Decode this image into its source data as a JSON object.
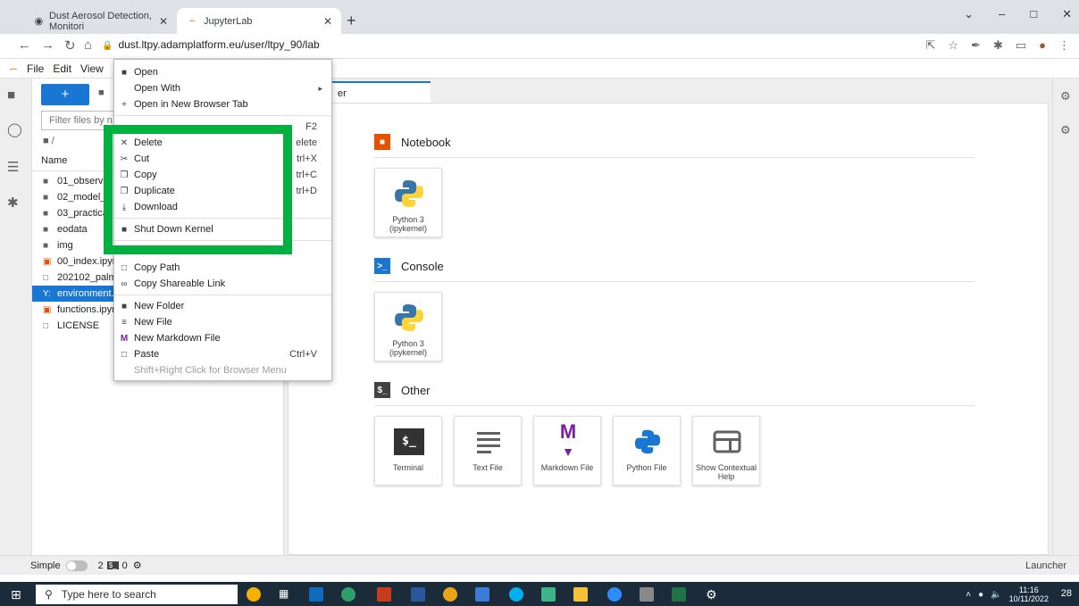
{
  "browser": {
    "tabs": [
      {
        "title": "Dust Aerosol Detection, Monitori",
        "active": false
      },
      {
        "title": "JupyterLab",
        "active": true
      }
    ],
    "url": "dust.ltpy.adamplatform.eu/user/ltpy_90/lab"
  },
  "jupyter": {
    "menus": [
      "File",
      "Edit",
      "View"
    ],
    "filter_placeholder": "Filter files by n",
    "breadcrumb": "/",
    "column_name": "Name",
    "files": [
      {
        "name": "01_observat",
        "type": "folder"
      },
      {
        "name": "02_model_f",
        "type": "folder"
      },
      {
        "name": "03_practical",
        "type": "folder"
      },
      {
        "name": "eodata",
        "type": "folder"
      },
      {
        "name": "img",
        "type": "folder"
      },
      {
        "name": "00_index.ipyn",
        "type": "notebook"
      },
      {
        "name": "202102_palma",
        "type": "file"
      },
      {
        "name": "environment.y",
        "type": "yaml",
        "selected": true
      },
      {
        "name": "functions.ipyn",
        "type": "notebook"
      },
      {
        "name": "LICENSE",
        "type": "file"
      }
    ],
    "launcher_tab": "er",
    "sections": {
      "notebook": "Notebook",
      "console": "Console",
      "other": "Other"
    },
    "cards": {
      "nb_python": "Python 3 (ipykernel)",
      "con_python": "Python 3 (ipykernel)",
      "terminal": "Terminal",
      "text_file": "Text File",
      "markdown_file": "Markdown File",
      "python_file": "Python File",
      "contextual_help": "Show Contextual Help"
    },
    "status": {
      "mode": "Simple",
      "terminals": "2",
      "kernels": "0",
      "right": "Launcher"
    }
  },
  "context_menu": {
    "items": [
      {
        "label": "Open",
        "shortcut": ""
      },
      {
        "label": "Open With",
        "shortcut": ""
      },
      {
        "label": "Open in New Browser Tab",
        "shortcut": ""
      },
      {
        "label": "",
        "shortcut": "F2"
      },
      {
        "label": "Delete",
        "shortcut": "elete"
      },
      {
        "label": "Cut",
        "shortcut": "trl+X"
      },
      {
        "label": "Copy",
        "shortcut": "trl+C"
      },
      {
        "label": "Duplicate",
        "shortcut": "trl+D"
      },
      {
        "label": "Download",
        "shortcut": ""
      },
      {
        "label": "Shut Down Kernel",
        "shortcut": ""
      },
      {
        "label": "Copy Path",
        "shortcut": ""
      },
      {
        "label": "Copy Shareable Link",
        "shortcut": ""
      },
      {
        "label": "New Folder",
        "shortcut": ""
      },
      {
        "label": "New File",
        "shortcut": ""
      },
      {
        "label": "New Markdown File",
        "shortcut": ""
      },
      {
        "label": "Paste",
        "shortcut": "Ctrl+V"
      },
      {
        "label": "Shift+Right Click for Browser Menu",
        "shortcut": ""
      }
    ]
  },
  "taskbar": {
    "search_placeholder": "Type here to search",
    "time": "11:16",
    "date": "10/11/2022",
    "notifications": "28"
  },
  "colors": {
    "jupyter_blue": "#1976d2",
    "jupyter_orange": "#f37726",
    "highlight_green": "#00b140"
  }
}
